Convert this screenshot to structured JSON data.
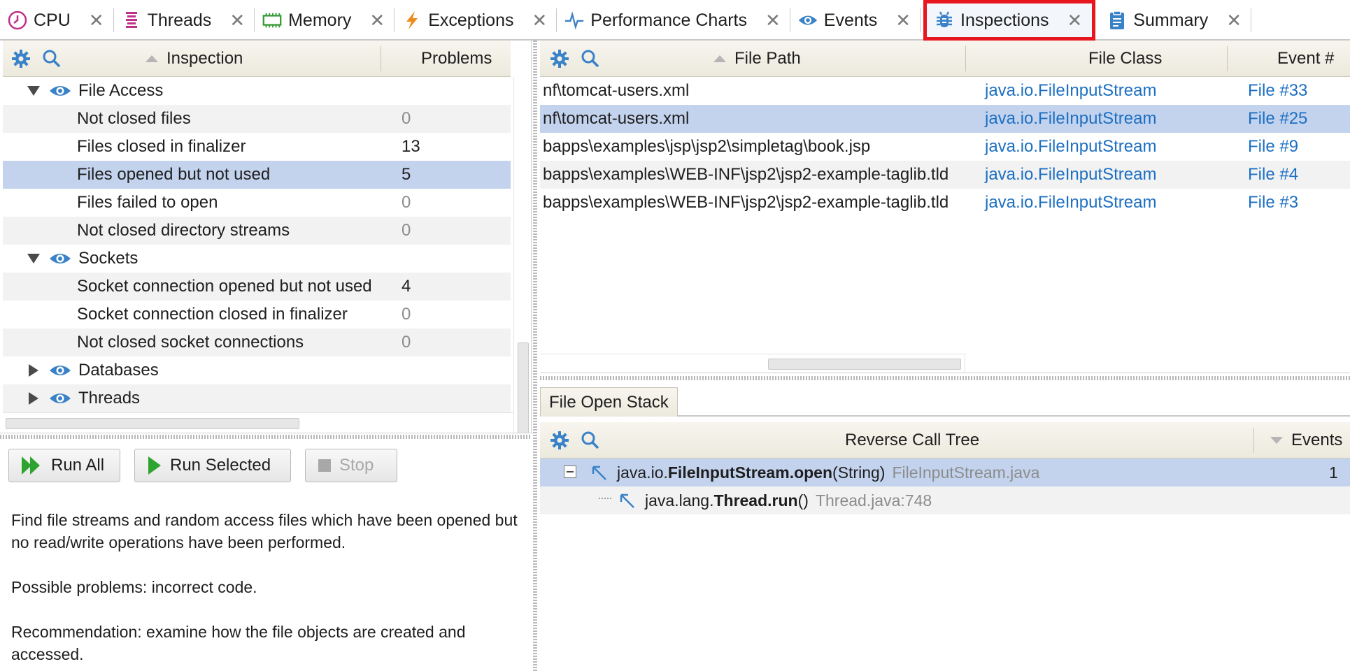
{
  "tabs": [
    {
      "label": "CPU",
      "icon": "cpu-clock-icon",
      "color": "#c0308a"
    },
    {
      "label": "Threads",
      "icon": "threads-icon",
      "color": "#c0308a"
    },
    {
      "label": "Memory",
      "icon": "memory-chip-icon",
      "color": "#3a9a3a"
    },
    {
      "label": "Exceptions",
      "icon": "lightning-icon",
      "color": "#f08a1c"
    },
    {
      "label": "Performance Charts",
      "icon": "pulse-chart-icon",
      "color": "#3a82c8"
    },
    {
      "label": "Events",
      "icon": "eye-icon",
      "color": "#3a82c8"
    },
    {
      "label": "Inspections",
      "icon": "bug-icon",
      "color": "#3a82c8",
      "active": true
    },
    {
      "label": "Summary",
      "icon": "clipboard-icon",
      "color": "#3a82c8"
    }
  ],
  "inspections": {
    "header": {
      "inspection": "Inspection",
      "problems": "Problems"
    },
    "rows": [
      {
        "kind": "group",
        "label": "File Access",
        "expanded": true
      },
      {
        "kind": "item",
        "label": "Not closed files",
        "count": "0"
      },
      {
        "kind": "item",
        "label": "Files closed in finalizer",
        "count": "13"
      },
      {
        "kind": "item",
        "label": "Files opened but not used",
        "count": "5",
        "selected": true
      },
      {
        "kind": "item",
        "label": "Files failed to open",
        "count": "0"
      },
      {
        "kind": "item",
        "label": "Not closed directory streams",
        "count": "0"
      },
      {
        "kind": "group",
        "label": "Sockets",
        "expanded": true
      },
      {
        "kind": "item",
        "label": "Socket connection opened but not used",
        "count": "4"
      },
      {
        "kind": "item",
        "label": "Socket connection closed in finalizer",
        "count": "0"
      },
      {
        "kind": "item",
        "label": "Not closed socket connections",
        "count": "0"
      },
      {
        "kind": "group",
        "label": "Databases",
        "expanded": false
      },
      {
        "kind": "group",
        "label": "Threads",
        "expanded": false
      }
    ]
  },
  "buttons": {
    "run_all": "Run All",
    "run_selected": "Run Selected",
    "stop": "Stop"
  },
  "description": {
    "p1": "Find file streams and random access files which have been opened but no read/write operations have been performed.",
    "p2": "Possible problems: incorrect code.",
    "p3": "Recommendation: examine how the file objects are created and accessed."
  },
  "files": {
    "header": {
      "path": "File Path",
      "cls": "File Class",
      "event": "Event #"
    },
    "rows": [
      {
        "path": "nf\\tomcat-users.xml",
        "cls": "java.io.FileInputStream",
        "event": "File #33"
      },
      {
        "path": "nf\\tomcat-users.xml",
        "cls": "java.io.FileInputStream",
        "event": "File #25",
        "selected": true
      },
      {
        "path": "bapps\\examples\\jsp\\jsp2\\simpletag\\book.jsp",
        "cls": "java.io.FileInputStream",
        "event": "File #9"
      },
      {
        "path": "bapps\\examples\\WEB-INF\\jsp2\\jsp2-example-taglib.tld",
        "cls": "java.io.FileInputStream",
        "event": "File #4"
      },
      {
        "path": "bapps\\examples\\WEB-INF\\jsp2\\jsp2-example-taglib.tld",
        "cls": "java.io.FileInputStream",
        "event": "File #3"
      }
    ]
  },
  "stack": {
    "subtab": "File Open Stack",
    "header": {
      "tree": "Reverse Call Tree",
      "events": "Events"
    },
    "rows": [
      {
        "pkg": "java.io.",
        "cls": "FileInputStream",
        "method": ".open",
        "args": "(String)",
        "src": "FileInputStream.java",
        "count": "1"
      },
      {
        "pkg": "java.lang.",
        "cls": "Thread",
        "method": ".run",
        "args": "()",
        "src": "Thread.java:748",
        "count": ""
      }
    ]
  },
  "colors": {
    "accent": "#3a82c8",
    "selection": "#c3d3ee",
    "link": "#1c6fc2",
    "highlight_frame": "#e8161e"
  }
}
